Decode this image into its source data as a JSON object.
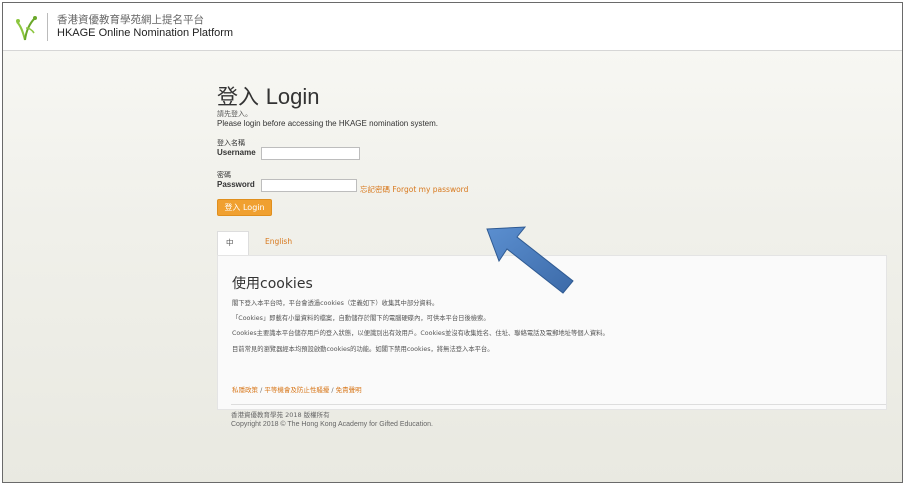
{
  "header": {
    "title_zh": "香港資優教育學苑網上提名平台",
    "title_en": "HKAGE Online Nomination Platform",
    "logo_icon": "hkage-logo-icon"
  },
  "login": {
    "title_zh": "登入",
    "title_en": "Login",
    "intro_zh": "請先登入。",
    "intro_en": "Please login before accessing the HKAGE nomination system.",
    "username_label_zh": "登入名稱",
    "username_label_en": "Username",
    "username_value": "",
    "password_label_zh": "密碼",
    "password_label_en": "Password",
    "password_value": "",
    "forgot_link": "忘記密碼 Forgot my password",
    "login_button": "登入 Login"
  },
  "tabs": [
    {
      "label": "中文",
      "active": true
    },
    {
      "label": "English",
      "active": false
    }
  ],
  "cookies": {
    "title": "使用cookies",
    "lines": [
      "閣下登入本平台時，平台會透過cookies（定義如下）收集其中部分資料。",
      "「Cookies」即載有小量資料的檔案，自動儲存於閣下的電腦硬碟內，可供本平台日後檢索。",
      "Cookies主要識本平台儲存用戶的登入狀態，以便識別出有效用戶。Cookies並沒有收集姓名、住址、聯絡電話及電郵地址等個人資料。",
      "目前常見的瀏覽器經本均預設啟動cookies的功能。如閣下禁用cookies，將無法登入本平台。"
    ],
    "links": [
      "私隱政策",
      "平等機會及防止性騷擾",
      "免責聲明"
    ],
    "separator": " / "
  },
  "footer": {
    "line_zh": "香港資優教育學苑 2018 版權所有",
    "line_en": "Copyright 2018 © The Hong Kong Academy for Gifted Education."
  },
  "colors": {
    "accent_orange": "#f0a030",
    "link_orange": "#d8781c",
    "arrow_blue": "#4a7fc1",
    "logo_green": "#8cc63f"
  },
  "annotation": {
    "icon": "blue-arrow-icon"
  }
}
